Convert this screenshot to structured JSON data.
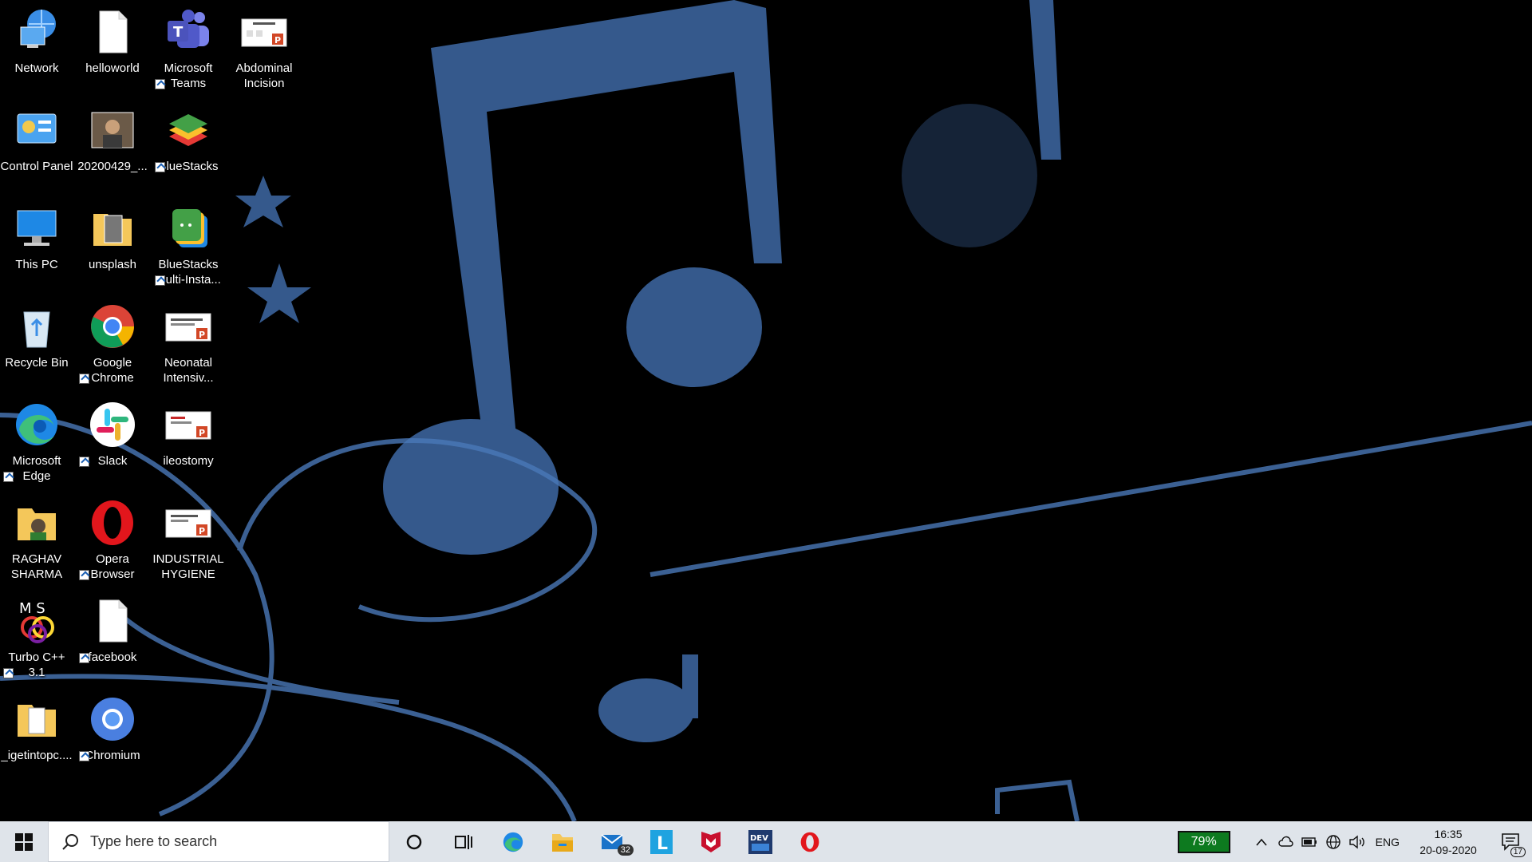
{
  "desktop": {
    "icons": [
      {
        "label": "Network",
        "icon": "network-icon"
      },
      {
        "label": "helloworld",
        "icon": "text-file-icon"
      },
      {
        "label": "Microsoft Teams",
        "icon": "teams-icon"
      },
      {
        "label": "Abdominal Incision",
        "icon": "powerpoint-file-icon"
      },
      {
        "label": "Control Panel",
        "icon": "control-panel-icon"
      },
      {
        "label": "20200429_...",
        "icon": "photo-icon"
      },
      {
        "label": "BlueStacks",
        "icon": "bluestacks-icon"
      },
      {
        "label": "This PC",
        "icon": "this-pc-icon"
      },
      {
        "label": "unsplash",
        "icon": "folder-icon"
      },
      {
        "label": "BlueStacks Multi-Insta...",
        "icon": "bluestacks-multi-icon"
      },
      {
        "label": "Recycle Bin",
        "icon": "recycle-bin-icon"
      },
      {
        "label": "Google Chrome",
        "icon": "chrome-icon"
      },
      {
        "label": "Neonatal Intensiv...",
        "icon": "powerpoint-file-icon"
      },
      {
        "label": "Microsoft Edge",
        "icon": "edge-icon"
      },
      {
        "label": "Slack",
        "icon": "slack-icon"
      },
      {
        "label": "ileostomy",
        "icon": "powerpoint-file-icon"
      },
      {
        "label": "RAGHAV SHARMA",
        "icon": "folder-icon"
      },
      {
        "label": "Opera Browser",
        "icon": "opera-icon"
      },
      {
        "label": "INDUSTRIAL HYGIENE",
        "icon": "powerpoint-file-icon"
      },
      {
        "label": "Turbo C++ 3.1",
        "icon": "turbo-cpp-icon"
      },
      {
        "label": "facebook",
        "icon": "file-shortcut-icon"
      },
      {
        "label": "_igetintopc....",
        "icon": "folder-icon"
      },
      {
        "label": "Chromium",
        "icon": "chromium-icon"
      }
    ]
  },
  "taskbar": {
    "search_placeholder": "Type here to search",
    "apps": [
      "cortana-icon",
      "task-view-icon",
      "edge-icon",
      "file-explorer-icon",
      "mail-icon",
      "l-app-icon",
      "mcafee-icon",
      "dev-app-icon",
      "opera-icon"
    ],
    "mail_badge": "32",
    "battery_percent": "79%",
    "language": "ENG",
    "time": "16:35",
    "date": "20-09-2020",
    "notification_count": "17"
  },
  "colors": {
    "wallpaper_bg": "#000000",
    "wallpaper_accent": "#4a78b8",
    "taskbar_bg": "#dfe4ea",
    "battery_green": "#0d7a1f"
  }
}
